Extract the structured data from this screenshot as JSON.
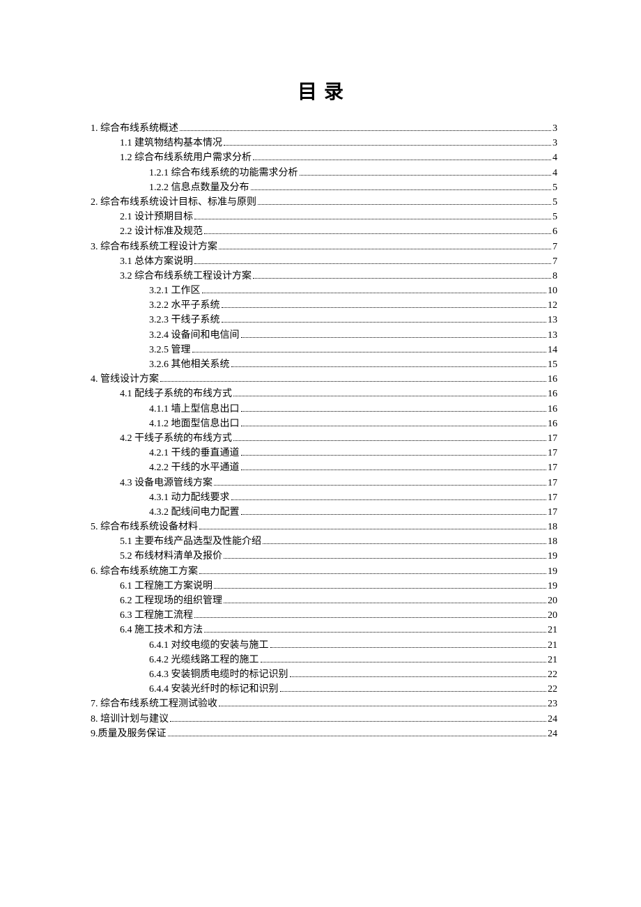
{
  "title": "目录",
  "entries": [
    {
      "level": 1,
      "label": "1. 综合布线系统概述",
      "page": "3"
    },
    {
      "level": 2,
      "label": "1.1 建筑物结构基本情况",
      "page": "3"
    },
    {
      "level": 2,
      "label": "1.2 综合布线系统用户需求分析",
      "page": "4"
    },
    {
      "level": 3,
      "label": "1.2.1 综合布线系统的功能需求分析",
      "page": "4"
    },
    {
      "level": 3,
      "label": "1.2.2 信息点数量及分布",
      "page": "5"
    },
    {
      "level": 1,
      "label": "2. 综合布线系统设计目标、标准与原则",
      "page": "5"
    },
    {
      "level": 2,
      "label": "2.1 设计预期目标",
      "page": "5"
    },
    {
      "level": 2,
      "label": "2.2 设计标准及规范",
      "page": "6"
    },
    {
      "level": 1,
      "label": "3. 综合布线系统工程设计方案",
      "page": "7"
    },
    {
      "level": 2,
      "label": "3.1 总体方案说明",
      "page": "7"
    },
    {
      "level": 2,
      "label": "3.2 综合布线系统工程设计方案",
      "page": "8"
    },
    {
      "level": 3,
      "label": "3.2.1 工作区",
      "page": "10"
    },
    {
      "level": 3,
      "label": "3.2.2 水平子系统",
      "page": "12"
    },
    {
      "level": 3,
      "label": "3.2.3 干线子系统",
      "page": "13"
    },
    {
      "level": 3,
      "label": "3.2.4 设备间和电信间",
      "page": "13"
    },
    {
      "level": 3,
      "label": "3.2.5 管理",
      "page": "14"
    },
    {
      "level": 3,
      "label": "3.2.6 其他相关系统",
      "page": "15"
    },
    {
      "level": 1,
      "label": "4. 管线设计方案",
      "page": "16"
    },
    {
      "level": 2,
      "label": "4.1 配线子系统的布线方式",
      "page": "16"
    },
    {
      "level": 3,
      "label": "4.1.1  墙上型信息出口",
      "page": "16"
    },
    {
      "level": 3,
      "label": "4.1.2 地面型信息出口",
      "page": "16"
    },
    {
      "level": 2,
      "label": "4.2 干线子系统的布线方式",
      "page": "17"
    },
    {
      "level": 3,
      "label": "4.2.1  干线的垂直通道",
      "page": "17"
    },
    {
      "level": 3,
      "label": "4.2.2  干线的水平通道",
      "page": "17"
    },
    {
      "level": 2,
      "label": "4.3 设备电源管线方案",
      "page": "17"
    },
    {
      "level": 3,
      "label": "4.3.1 动力配线要求",
      "page": "17"
    },
    {
      "level": 3,
      "label": "4.3.2 配线间电力配置",
      "page": "17"
    },
    {
      "level": 1,
      "label": "5. 综合布线系统设备材料",
      "page": "18"
    },
    {
      "level": 2,
      "label": "5.1 主要布线产品选型及性能介绍",
      "page": "18"
    },
    {
      "level": 2,
      "label": "5.2 布线材料清单及报价",
      "page": "19"
    },
    {
      "level": 1,
      "label": "6. 综合布线系统施工方案",
      "page": "19"
    },
    {
      "level": 2,
      "label": "6.1 工程施工方案说明",
      "page": "19"
    },
    {
      "level": 2,
      "label": "6.2 工程现场的组织管理",
      "page": "20"
    },
    {
      "level": 2,
      "label": "6.3 工程施工流程",
      "page": "20"
    },
    {
      "level": 2,
      "label": "6.4 施工技术和方法",
      "page": "21"
    },
    {
      "level": 3,
      "label": "6.4.1 对绞电缆的安装与施工",
      "page": "21"
    },
    {
      "level": 3,
      "label": "6.4.2  光缆线路工程的施工",
      "page": "21"
    },
    {
      "level": 3,
      "label": "6.4.3  安装铜质电缆时的标记识别",
      "page": "22"
    },
    {
      "level": 3,
      "label": "6.4.4  安装光纤时的标记和识别",
      "page": "22"
    },
    {
      "level": 1,
      "label": "7. 综合布线系统工程测试验收",
      "page": "23"
    },
    {
      "level": 1,
      "label": "8. 培训计划与建议",
      "page": "24"
    },
    {
      "level": 1,
      "label": "9.质量及服务保证",
      "page": "24"
    }
  ]
}
